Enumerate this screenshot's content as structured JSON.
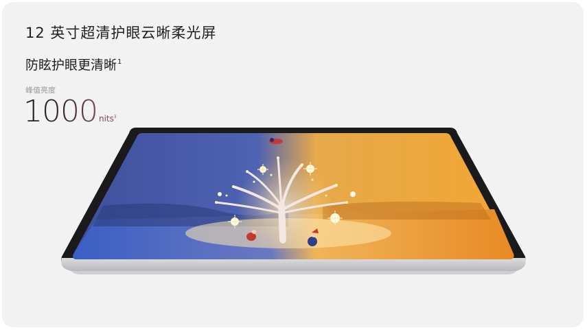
{
  "heading": {
    "title": "12 英寸超清护眼云晰柔光屏",
    "subtitle": "防眩护眼更清晰",
    "subtitle_footnote": "1"
  },
  "metric": {
    "label": "峰值亮度",
    "value": "1000",
    "unit": "nits",
    "unit_footnote": "3"
  },
  "colors": {
    "card_background": "#f2f2f3",
    "text_primary": "#1f1f1f",
    "text_muted": "#9a9a9a",
    "accent_unit": "#8a4a57",
    "screen_left": "#4a5fb0",
    "screen_right": "#f0a030"
  },
  "illustration": {
    "subject": "tablet-screen-artwork",
    "icon": "tablet-device-icon"
  }
}
